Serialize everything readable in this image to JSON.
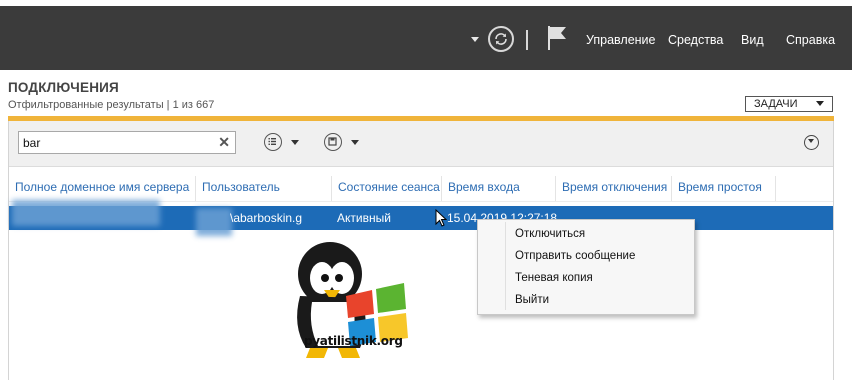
{
  "toolbar": {
    "menu": [
      {
        "label": "Управление"
      },
      {
        "label": "Средства"
      },
      {
        "label": "Вид"
      },
      {
        "label": "Справка"
      }
    ]
  },
  "header": {
    "title": "ПОДКЛЮЧЕНИЯ",
    "subtitle": "Отфильтрованные результаты | 1 из 667",
    "tasks_label": "ЗАДАЧИ"
  },
  "filter": {
    "search_value": "bar",
    "clear_glyph": "✕"
  },
  "table": {
    "columns": [
      "Полное доменное имя сервера",
      "Пользователь",
      "Состояние сеанса",
      "Время входа",
      "Время отключения",
      "Время простоя"
    ],
    "rows": [
      {
        "server": "",
        "user": "\\abarboskin.g",
        "state": "Активный",
        "login_time": "15.04.2019 12:27:18",
        "disconnect_time": "",
        "idle_time": ""
      }
    ]
  },
  "context_menu": {
    "items": [
      {
        "label": "Отключиться"
      },
      {
        "label": "Отправить сообщение"
      },
      {
        "label": "Теневая копия"
      },
      {
        "label": "Выйти"
      }
    ]
  },
  "watermark": {
    "text": "pyatilistnik.org"
  },
  "colors": {
    "topbar": "#3b3b3b",
    "accent": "#f0b43a",
    "selection": "#1d6bb7",
    "header_text": "#2e6db3"
  },
  "icons": [
    "dropdown-caret-icon",
    "refresh-icon",
    "flag-icon",
    "list-filter-icon",
    "save-filter-icon",
    "expand-icon",
    "mouse-cursor-icon"
  ]
}
